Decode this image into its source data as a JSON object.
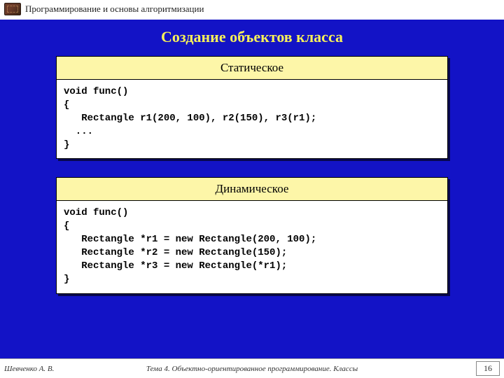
{
  "header": {
    "course": "Программирование и основы алгоритмизации"
  },
  "slide": {
    "title": "Создание объектов класса",
    "static": {
      "label": "Статическое",
      "code": "void func()\n{\n   Rectangle r1(200, 100), r2(150), r3(r1);\n  ...\n}"
    },
    "dynamic": {
      "label": "Динамическое",
      "code": "void func()\n{\n   Rectangle *r1 = new Rectangle(200, 100);\n   Rectangle *r2 = new Rectangle(150);\n   Rectangle *r3 = new Rectangle(*r1);\n}"
    }
  },
  "footer": {
    "author": "Шевченко А. В.",
    "topic": "Тема 4. Объектно-ориентированное программирование. Классы",
    "page": "16"
  }
}
